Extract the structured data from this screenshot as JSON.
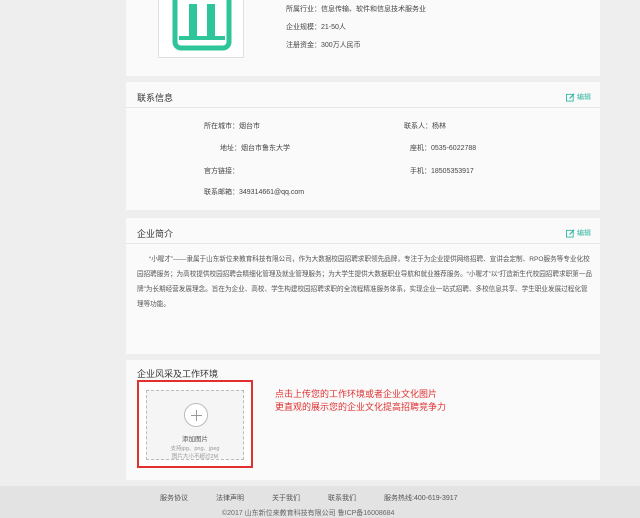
{
  "company": {
    "industry": "所属行业：信息传输、软件和信息技术服务业",
    "scale": "企业规模：21-50人",
    "capital": "注册资金：300万人民币"
  },
  "contact": {
    "title": "联系信息",
    "edit_label": "编辑",
    "city_label": "所在城市：",
    "city_value": "烟台市",
    "address_label": "地址：",
    "address_value": "烟台市鲁东大学",
    "website_label": "官方链接：",
    "website_value": "",
    "email_label": "联系邮箱：",
    "email_value": "349314661@qq.com",
    "person_label": "联系人：",
    "person_value": "杨林",
    "phone_label": "座机：",
    "phone_value": "0535-6022788",
    "mobile_label": "手机：",
    "mobile_value": "18505353917"
  },
  "intro": {
    "title": "企业简介",
    "edit_label": "编辑",
    "text": "“小喔才”——隶属于山东新位来教育科技有限公司，作为大数据校园招聘求职领先品牌，专注于为企业提供网络招聘、宣讲会定制、RPO服务等专业化校园招聘服务；为高校提供校园招聘会精细化管理及就业管理服务；为大学生提供大数据职业导航和就业推荐服务。“小喔才”以“打造新生代校园招聘求职第一品牌”为长期经营发展理念。旨在为企业、高校、学生构建校园招聘求职的全流程精准服务体系，实现企业一站式招聘、多校信息共享、学生职业发展过程化管理等功能。"
  },
  "environment": {
    "title": "企业风采及工作环境",
    "upload_label": "添加图片",
    "upload_hint1": "支持jpg、png、jpeg",
    "upload_hint2": "图片大小不超过2M",
    "annotation_line1": "点击上传您的工作环境或者企业文化图片",
    "annotation_line2": "更直观的展示您的企业文化提高招聘竞争力"
  },
  "footer": {
    "links": [
      "服务协议",
      "法律声明",
      "关于我们",
      "联系我们",
      "服务热线:400-619-3917"
    ],
    "copyright": "©2017 山东新位来教育科技有限公司 鲁ICP备16008684"
  },
  "colors": {
    "accent": "#33b5a0",
    "annotation": "#e03131"
  }
}
